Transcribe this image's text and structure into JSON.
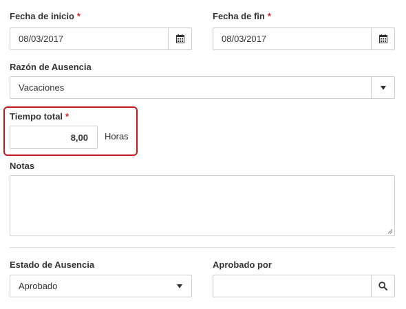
{
  "start_date": {
    "label": "Fecha de inicio",
    "required_mark": "*",
    "value": "08/03/2017",
    "icon": "calendar-icon"
  },
  "end_date": {
    "label": "Fecha de fin",
    "required_mark": "*",
    "value": "08/03/2017",
    "icon": "calendar-icon"
  },
  "absence_reason": {
    "label": "Razón de Ausencia",
    "value": "Vacaciones",
    "icon": "caret-down-icon"
  },
  "total_time": {
    "label": "Tiempo total",
    "required_mark": "*",
    "value": "8,00",
    "unit": "Horas"
  },
  "notes": {
    "label": "Notas",
    "value": ""
  },
  "absence_status": {
    "label": "Estado de Ausencia",
    "value": "Aprobado",
    "icon": "caret-down-icon"
  },
  "approved_by": {
    "label": "Aprobado por",
    "value": "",
    "icon": "search-icon"
  },
  "colors": {
    "required": "#d0212b",
    "highlight": "#c4161c",
    "border": "#cccccc"
  }
}
